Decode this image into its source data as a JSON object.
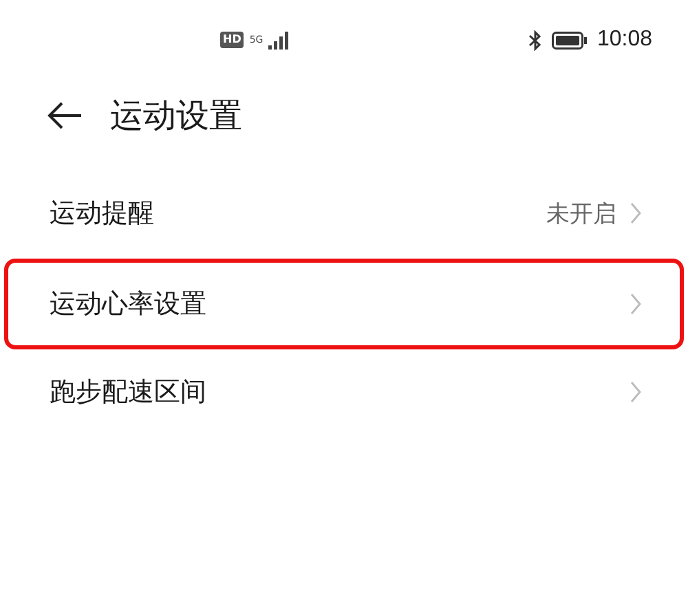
{
  "status_bar": {
    "hd": "HD",
    "network": "5G",
    "time": "10:08"
  },
  "header": {
    "title": "运动设置"
  },
  "items": [
    {
      "label": "运动提醒",
      "value": "未开启",
      "highlighted": false
    },
    {
      "label": "运动心率设置",
      "highlighted": true
    },
    {
      "label": "跑步配速区间",
      "highlighted": false
    }
  ]
}
